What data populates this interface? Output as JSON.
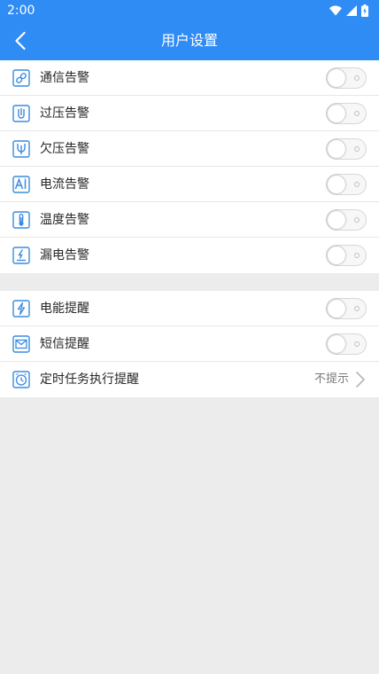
{
  "status_bar": {
    "time": "2:00",
    "icons": [
      "wifi-icon",
      "signal-icon",
      "battery-charging-icon"
    ]
  },
  "header": {
    "title": "用户设置",
    "back_icon": "chevron-left-icon"
  },
  "alarm_settings": [
    {
      "id": "comm",
      "label": "通信告警",
      "icon": "link-icon",
      "enabled": false
    },
    {
      "id": "overvoltage",
      "label": "过压告警",
      "icon": "overvoltage-icon",
      "enabled": false
    },
    {
      "id": "undervoltage",
      "label": "欠压告警",
      "icon": "undervoltage-icon",
      "enabled": false
    },
    {
      "id": "current",
      "label": "电流告警",
      "icon": "current-icon",
      "enabled": false
    },
    {
      "id": "temperature",
      "label": "温度告警",
      "icon": "thermometer-icon",
      "enabled": false
    },
    {
      "id": "leakage",
      "label": "漏电告警",
      "icon": "leakage-icon",
      "enabled": false
    }
  ],
  "reminder_settings": [
    {
      "id": "energy",
      "label": "电能提醒",
      "icon": "lightning-icon",
      "enabled": false
    },
    {
      "id": "sms",
      "label": "短信提醒",
      "icon": "mail-icon",
      "enabled": false
    }
  ],
  "scheduled_task": {
    "label": "定时任务执行提醒",
    "icon": "clock-icon",
    "value": "不提示",
    "chevron_icon": "chevron-right-icon"
  },
  "colors": {
    "primary": "#2f8cf4",
    "icon_blue": "#3a8be0",
    "background": "#ececec",
    "divider": "#e6e6e6"
  }
}
